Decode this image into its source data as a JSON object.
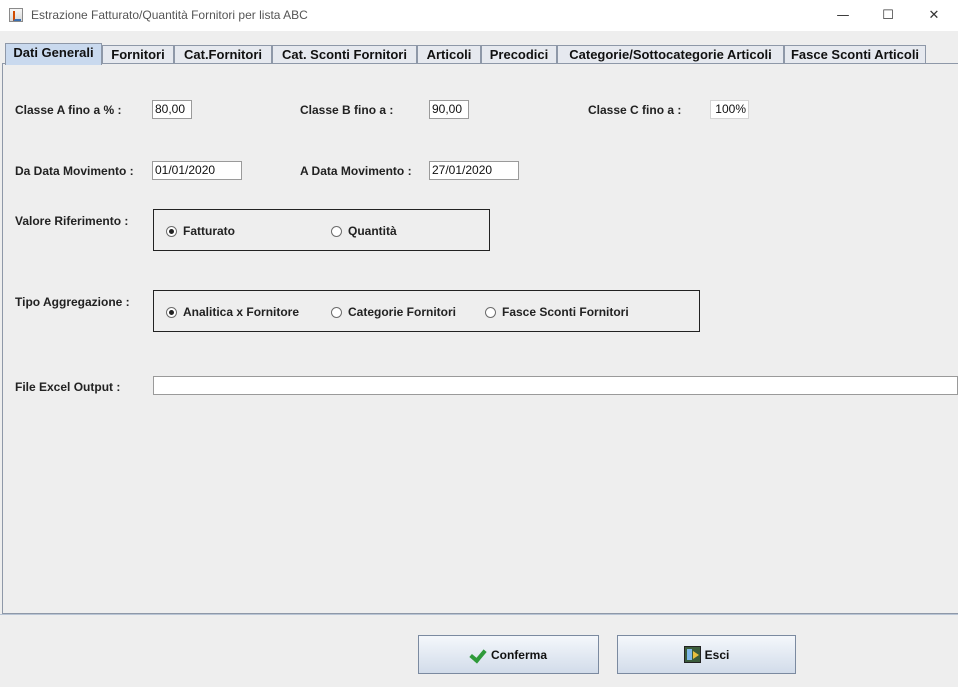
{
  "window": {
    "title": "Estrazione Fatturato/Quantità Fornitori per lista ABC"
  },
  "tabs": [
    {
      "label": "Dati Generali",
      "active": true
    },
    {
      "label": "Fornitori"
    },
    {
      "label": "Cat.Fornitori"
    },
    {
      "label": "Cat. Sconti Fornitori"
    },
    {
      "label": "Articoli"
    },
    {
      "label": "Precodici"
    },
    {
      "label": "Categorie/Sottocategorie Articoli"
    },
    {
      "label": "Fasce Sconti Articoli"
    }
  ],
  "form": {
    "classe_a_label": "Classe A  fino a % :",
    "classe_a_value": "80,00",
    "classe_b_label": "Classe B  fino a :",
    "classe_b_value": "90,00",
    "classe_c_label": "Classe C  fino a :",
    "classe_c_value": "100%",
    "da_data_label": "Da Data Movimento :",
    "da_data_value": "01/01/2020",
    "a_data_label": "A  Data Movimento :",
    "a_data_value": "27/01/2020",
    "valore_label": "Valore Riferimento :",
    "valore_options": [
      "Fatturato",
      "Quantità"
    ],
    "valore_selected": "Fatturato",
    "tipo_label": "Tipo Aggregazione :",
    "tipo_options": [
      "Analitica x Fornitore",
      "Categorie Fornitori",
      "Fasce Sconti Fornitori"
    ],
    "tipo_selected": "Analitica x Fornitore",
    "file_label": "File Excel Output :",
    "file_value": ""
  },
  "buttons": {
    "confirm": "Conferma",
    "exit": "Esci"
  },
  "icons": {
    "app": "java-cup-icon",
    "confirm": "checkmark-icon",
    "exit": "exit-door-icon"
  }
}
